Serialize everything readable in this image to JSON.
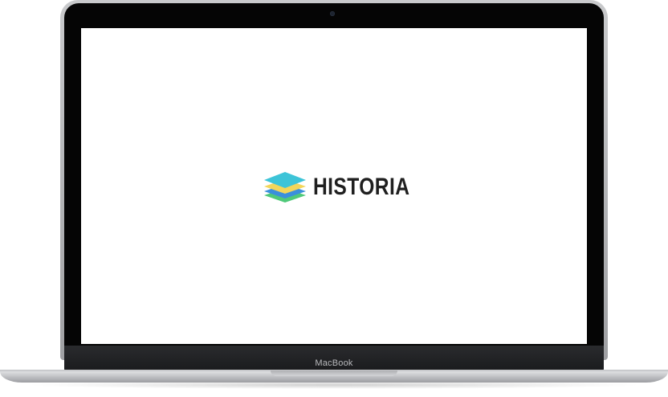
{
  "device": {
    "brand_label": "MacBook"
  },
  "screen": {
    "logo": {
      "text": "HISTORIA",
      "icon": "stacked-layers-icon",
      "colors": {
        "top_layer": "#3dc4d8",
        "middle_layer": "#f3d65a",
        "lower_layer": "#3b8fdc",
        "bottom_layer": "#4fc97a",
        "text": "#1f1f1f"
      }
    }
  }
}
